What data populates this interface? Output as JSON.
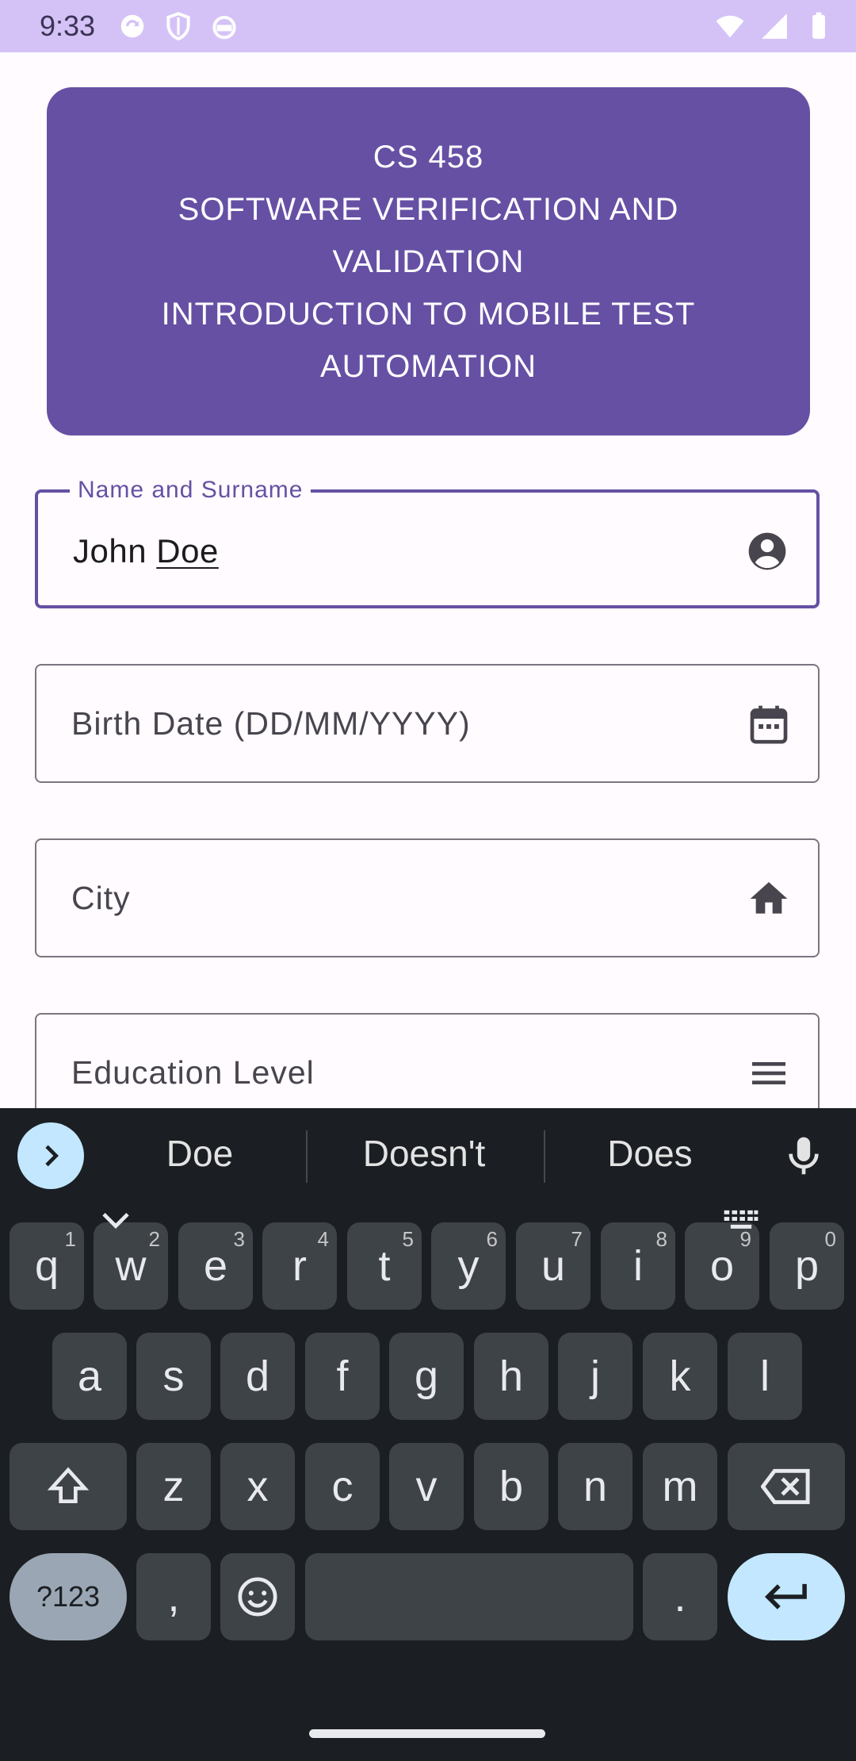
{
  "status_bar": {
    "time": "9:33",
    "left_icons": [
      "sync-icon",
      "shield-icon",
      "android-icon"
    ],
    "right_icons": [
      "wifi-icon",
      "signal-icon",
      "battery-icon"
    ],
    "background": "#d4c2f7"
  },
  "header": {
    "lines": [
      "CS 458",
      "SOFTWARE VERIFICATION AND",
      "VALIDATION",
      "INTRODUCTION TO MOBILE TEST",
      "AUTOMATION"
    ],
    "background": "#6650a4"
  },
  "form": {
    "name": {
      "label": "Name and Surname",
      "value_first": "John",
      "value_second": "Doe",
      "icon": "account-circle-icon"
    },
    "birth_date": {
      "placeholder": "Birth Date (DD/MM/YYYY)",
      "icon": "calendar-icon"
    },
    "city": {
      "placeholder": "City",
      "icon": "home-icon"
    },
    "education": {
      "placeholder": "Education Level",
      "icon": "menu-icon"
    }
  },
  "keyboard": {
    "suggestions": [
      "Doe",
      "Doesn't",
      "Does"
    ],
    "row1": [
      {
        "key": "q",
        "hint": "1"
      },
      {
        "key": "w",
        "hint": "2"
      },
      {
        "key": "e",
        "hint": "3"
      },
      {
        "key": "r",
        "hint": "4"
      },
      {
        "key": "t",
        "hint": "5"
      },
      {
        "key": "y",
        "hint": "6"
      },
      {
        "key": "u",
        "hint": "7"
      },
      {
        "key": "i",
        "hint": "8"
      },
      {
        "key": "o",
        "hint": "9"
      },
      {
        "key": "p",
        "hint": "0"
      }
    ],
    "row2": [
      "a",
      "s",
      "d",
      "f",
      "g",
      "h",
      "j",
      "k",
      "l"
    ],
    "row3": [
      "z",
      "x",
      "c",
      "v",
      "b",
      "n",
      "m"
    ],
    "symbols_label": "?123",
    "comma": ",",
    "period": ".",
    "accent_color": "#c2e7ff"
  }
}
